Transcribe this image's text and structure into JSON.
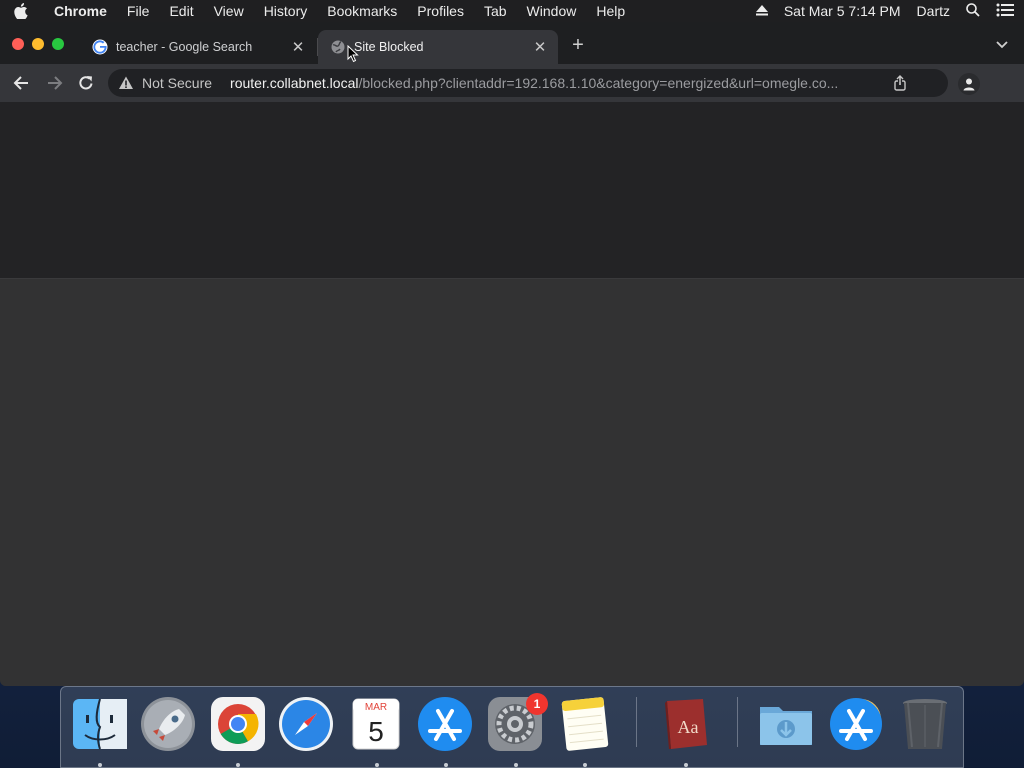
{
  "menubar": {
    "app_name": "Chrome",
    "menus": [
      "File",
      "Edit",
      "View",
      "History",
      "Bookmarks",
      "Profiles",
      "Tab",
      "Window",
      "Help"
    ],
    "datetime": "Sat Mar 5  7:14 PM",
    "user": "Dartz"
  },
  "browser": {
    "tabs": [
      {
        "title": "teacher - Google Search",
        "active": false
      },
      {
        "title": "Site Blocked",
        "active": true
      }
    ],
    "omnibox": {
      "security_label": "Not Secure",
      "url_host": "router.collabnet.local",
      "url_path": "/blocked.php?clientaddr=192.168.1.10&category=energized&url=omegle.co..."
    }
  },
  "dock": {
    "apps": [
      {
        "name": "Finder",
        "running": true
      },
      {
        "name": "Launchpad",
        "running": false
      },
      {
        "name": "Google Chrome",
        "running": true
      },
      {
        "name": "Safari",
        "running": false
      },
      {
        "name": "Calendar",
        "running": true,
        "month": "MAR",
        "day": "5"
      },
      {
        "name": "App Store",
        "running": true
      },
      {
        "name": "System Preferences",
        "running": true,
        "badge": "1"
      },
      {
        "name": "Notes",
        "running": true
      },
      {
        "name": "Dictionary",
        "running": true,
        "label": "Aa"
      },
      {
        "name": "Downloads",
        "running": false
      },
      {
        "name": "Applications",
        "running": false
      },
      {
        "name": "Trash",
        "running": false
      }
    ]
  },
  "colors": {
    "traffic_red": "#fe5f57",
    "traffic_yellow": "#febc2e",
    "traffic_green": "#28c840",
    "badge_red": "#f0352e",
    "toolbar_bg": "#35363a"
  }
}
